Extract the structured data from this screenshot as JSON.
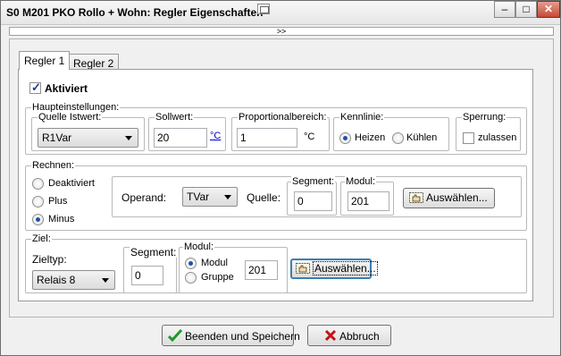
{
  "window": {
    "title": "S0 M201 PKO Rollo + Wohn: Regler Eigenschaften",
    "min_label": "–",
    "max_label": "□",
    "close_label": "✕"
  },
  "expander": {
    "label": ">>"
  },
  "tabs": [
    {
      "label": "Regler 1"
    },
    {
      "label": "Regler 2"
    }
  ],
  "aktiviert": {
    "label": "Aktiviert",
    "checked": true
  },
  "haupt": {
    "legend": "Haupteinstellungen:",
    "quelle": {
      "legend": "Quelle Istwert:",
      "value": "R1Var"
    },
    "sollwert": {
      "legend": "Sollwert:",
      "value": "20",
      "unit": "°C"
    },
    "prop": {
      "legend": "Proportionalbereich:",
      "value": "1",
      "unit": "°C"
    },
    "kennlinie": {
      "legend": "Kennlinie:",
      "options": [
        "Heizen",
        "Kühlen"
      ],
      "selected": "Heizen"
    },
    "sperrung": {
      "legend": "Sperrung:",
      "label": "zulassen"
    }
  },
  "rechnen": {
    "legend": "Rechnen:",
    "options": [
      "Deaktiviert",
      "Plus",
      "Minus"
    ],
    "selected": "Minus",
    "operand_label": "Operand:",
    "operand_value": "TVar",
    "quelle_label": "Quelle:",
    "segment": {
      "legend": "Segment:",
      "value": "0"
    },
    "modul": {
      "legend": "Modul:",
      "value": "201"
    },
    "auswaehlen": "Auswählen..."
  },
  "ziel": {
    "legend": "Ziel:",
    "zieltyp_label": "Zieltyp:",
    "zieltyp_value": "Relais 8",
    "segment": {
      "legend": "Segment:",
      "value": "0"
    },
    "modul": {
      "legend": "Modul:",
      "options": [
        "Modul",
        "Gruppe"
      ],
      "selected": "Modul",
      "value": "201"
    },
    "auswaehlen": "Auswählen..."
  },
  "footer": {
    "save_label": "Beenden und Speichern",
    "cancel_label": "Abbruch"
  },
  "colors": {
    "accent": "#1e50a8",
    "link": "#0000cc",
    "cancel_icon": "#c0141b",
    "save_icon": "#1e9a2c"
  },
  "icons": {
    "save": "check-icon",
    "cancel": "cross-icon",
    "select": "hand-pointer-icon"
  }
}
